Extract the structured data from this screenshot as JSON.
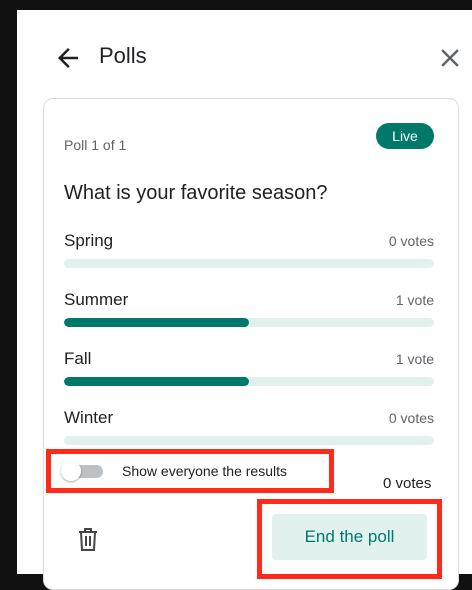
{
  "header": {
    "title": "Polls"
  },
  "card": {
    "poll_count": "Poll 1 of 1",
    "status_badge": "Live",
    "question": "What is your favorite season?",
    "options": [
      {
        "label": "Spring",
        "votes": "0 votes",
        "fraction": 0
      },
      {
        "label": "Summer",
        "votes": "1 vote",
        "fraction": 0.5
      },
      {
        "label": "Fall",
        "votes": "1 vote",
        "fraction": 0.5
      },
      {
        "label": "Winter",
        "votes": "0 votes",
        "fraction": 0
      }
    ],
    "show_results_label": "Show everyone the results",
    "show_results_on": false,
    "extra_votes": "0 votes",
    "end_button": "End the poll"
  },
  "colors": {
    "accent": "#00796b",
    "bar_track": "#e0f1ee",
    "highlight": "#ff2a1a"
  },
  "icons": {
    "back": "arrow-back-icon",
    "close": "close-icon",
    "delete": "trash-icon"
  }
}
